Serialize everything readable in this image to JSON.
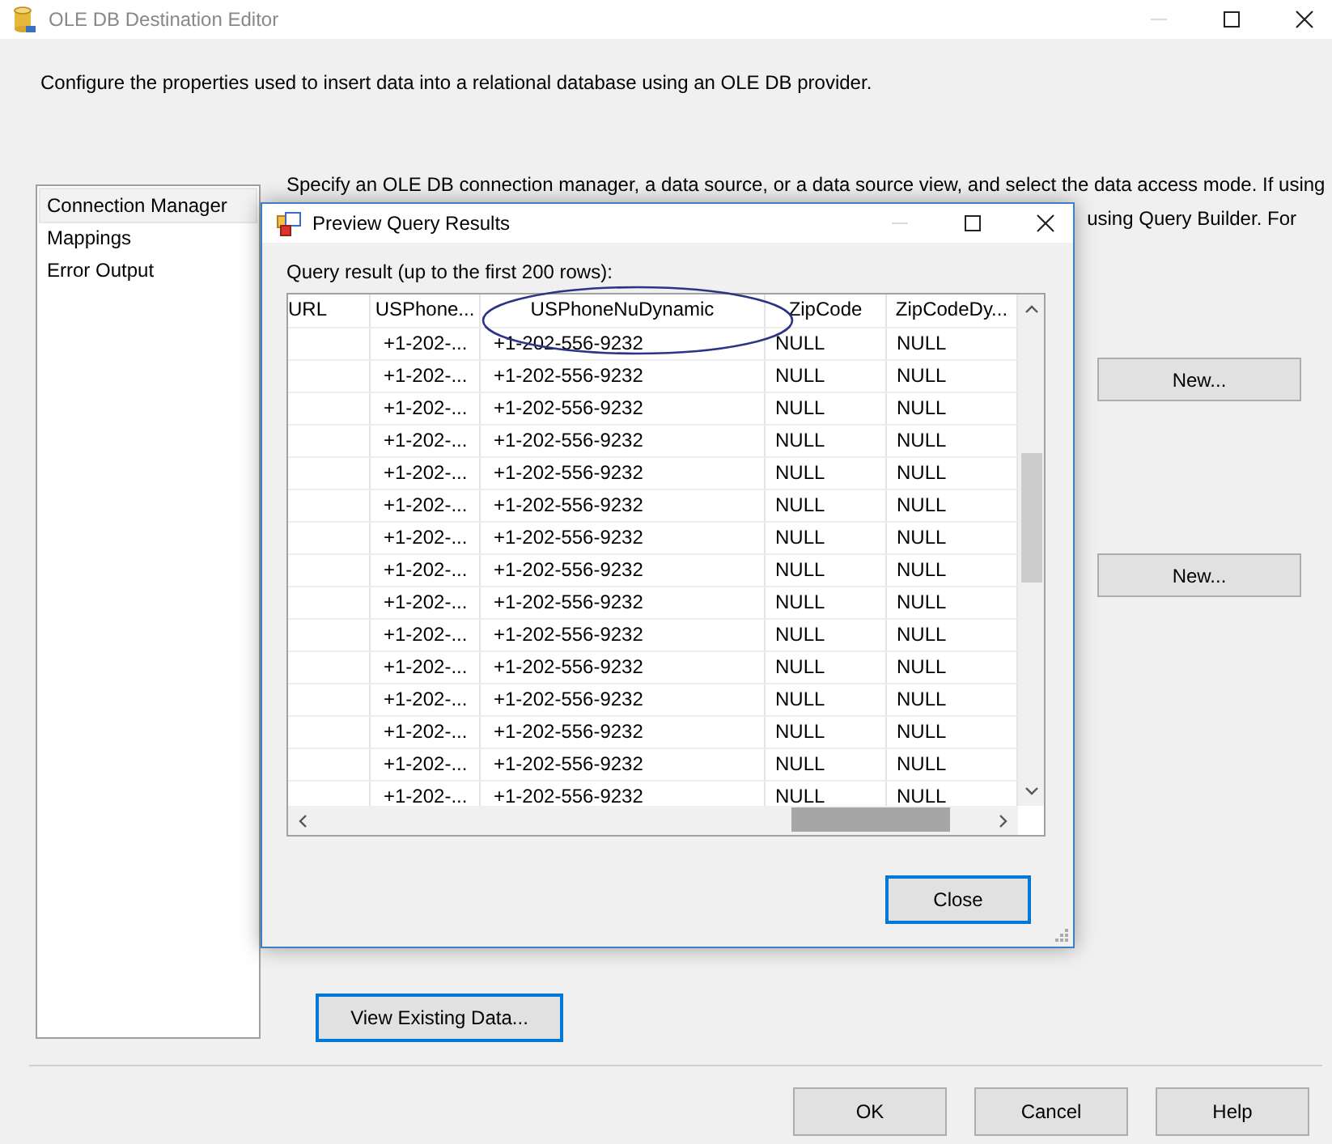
{
  "window": {
    "title": "OLE DB Destination Editor"
  },
  "description": "Configure the properties used to insert data into a relational database using an OLE DB provider.",
  "sidebar": {
    "items": [
      {
        "label": "Connection Manager",
        "selected": true
      },
      {
        "label": "Mappings",
        "selected": false
      },
      {
        "label": "Error Output",
        "selected": false
      }
    ]
  },
  "content": {
    "instructions_line_1": "Specify an OLE DB connection manager, a data source, or a data source view, and select the data access mode. If using",
    "instructions_line_2_visible": "using Query Builder. For",
    "new_buttons": [
      "New...",
      "New..."
    ],
    "view_button": "View Existing Data..."
  },
  "buttons": [
    "OK",
    "Cancel",
    "Help"
  ],
  "dialog": {
    "title": "Preview Query Results",
    "label": "Query result (up to the first 200 rows):",
    "columns": [
      "URL",
      "USPhone...",
      "USPhoneNuDynamic",
      "ZipCode",
      "ZipCodeDy..."
    ],
    "rows": [
      [
        "",
        "+1-202-...",
        "+1-202-556-9232",
        "NULL",
        "NULL"
      ],
      [
        "",
        "+1-202-...",
        "+1-202-556-9232",
        "NULL",
        "NULL"
      ],
      [
        "",
        "+1-202-...",
        "+1-202-556-9232",
        "NULL",
        "NULL"
      ],
      [
        "",
        "+1-202-...",
        "+1-202-556-9232",
        "NULL",
        "NULL"
      ],
      [
        "",
        "+1-202-...",
        "+1-202-556-9232",
        "NULL",
        "NULL"
      ],
      [
        "",
        "+1-202-...",
        "+1-202-556-9232",
        "NULL",
        "NULL"
      ],
      [
        "",
        "+1-202-...",
        "+1-202-556-9232",
        "NULL",
        "NULL"
      ],
      [
        "",
        "+1-202-...",
        "+1-202-556-9232",
        "NULL",
        "NULL"
      ],
      [
        "",
        "+1-202-...",
        "+1-202-556-9232",
        "NULL",
        "NULL"
      ],
      [
        "",
        "+1-202-...",
        "+1-202-556-9232",
        "NULL",
        "NULL"
      ],
      [
        "",
        "+1-202-...",
        "+1-202-556-9232",
        "NULL",
        "NULL"
      ],
      [
        "",
        "+1-202-...",
        "+1-202-556-9232",
        "NULL",
        "NULL"
      ],
      [
        "",
        "+1-202-...",
        "+1-202-556-9232",
        "NULL",
        "NULL"
      ],
      [
        "",
        "+1-202-...",
        "+1-202-556-9232",
        "NULL",
        "NULL"
      ],
      [
        "",
        "+1-202-...",
        "+1-202-556-9232",
        "NULL",
        "NULL"
      ]
    ],
    "close_button": "Close"
  }
}
